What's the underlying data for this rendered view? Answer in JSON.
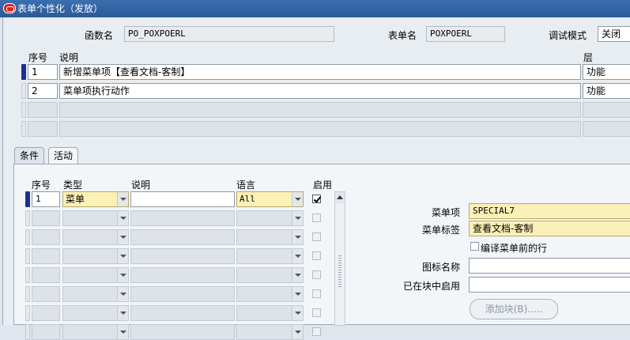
{
  "window": {
    "title": "表单个性化（发放）"
  },
  "header": {
    "function_label": "函数名",
    "function_value": "PO_POXPOERL",
    "form_label": "表单名",
    "form_value": "POXPOERL",
    "debug_label": "调试模式",
    "debug_value": "关闭"
  },
  "rules": {
    "col_seq": "序号",
    "col_desc": "说明",
    "col_level": "层",
    "rows": [
      {
        "seq": "1",
        "desc": "新增菜单项【查看文档-客制】",
        "level": "功能"
      },
      {
        "seq": "2",
        "desc": "菜单项执行动作",
        "level": "功能"
      }
    ]
  },
  "tabs": {
    "conditions": "条件",
    "actions": "活动"
  },
  "actions": {
    "col_seq": "序号",
    "col_type": "类型",
    "col_desc": "说明",
    "col_lang": "语言",
    "col_enabled": "启用",
    "rows": [
      {
        "seq": "1",
        "type": "菜单",
        "desc": "",
        "lang": "All",
        "enabled": true
      }
    ]
  },
  "details": {
    "menu_entry_label": "菜单项",
    "menu_entry_value": "SPECIAL7",
    "menu_label_label": "菜单标签",
    "menu_label_value": "查看文档-客制",
    "separator_label": "编译菜单前的行",
    "icon_label": "图标名称",
    "icon_value": "",
    "enabled_in_block_label": "已在块中启用",
    "enabled_in_block_value": "",
    "add_block_button": "添加块(B)....."
  }
}
